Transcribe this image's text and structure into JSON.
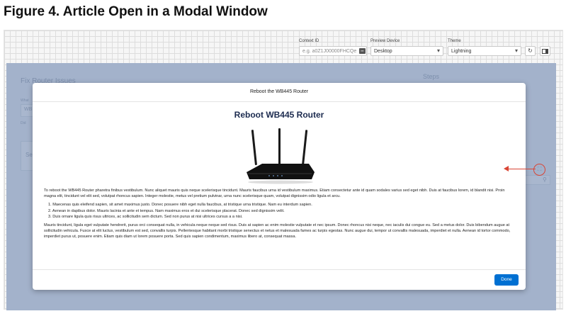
{
  "figure": {
    "title": "Figure 4. Article Open in a Modal Window"
  },
  "toolbar": {
    "context_id_label": "Context ID",
    "context_id_placeholder": "e.g. a0Z1J00000FHCQe",
    "preview_device_label": "Preview Device",
    "preview_device_value": "Desktop",
    "theme_label": "Theme",
    "theme_value": "Lightning",
    "icons": {
      "refresh": "refresh-icon",
      "preview": "preview-panel-icon"
    }
  },
  "background": {
    "page_title": "Fix Router Issues",
    "field_label_1": "What",
    "field_value_1": "WB",
    "field_label_2": "Did",
    "search_placeholder": "Se",
    "steps_label": "Steps"
  },
  "modal": {
    "header": "Reboot the WB445 Router",
    "article_title": "Reboot WB445 Router",
    "intro": "To reboot the WB445 Router pharetra finibus vestibulum. Nunc aliquet mauris quis neque scelerisque tincidunt. Mauris faucibus urna id vestibulum maximus. Etiam consectetur ante id quam sodales varius sed eget nibh. Duis at faucibus lorem, id blandit nisi. Proin magna elit, tincidunt vel elit sed, volutpat rhoncus sapien. Integer molestie, metus vel pretium pulvinar, urna nunc scelerisque quam, volutpat dignissim odio ligula et arcu.",
    "steps": [
      "1. Maecenas quis eleifend sapien, sit amet maximus justo. Donec posuere nibh eget nulla faucibus, at tristique urna tristique. Nam eu interdum sapien.",
      "2. Aenean in dapibus dolor. Mauris lacinia et ante et tempus. Nam maximus eros et dui scelerisque placerat. Donec sed dignissim velit.",
      "3. Duis ornare ligula quis risus ultrices, ac sollicitudin sem dictum. Sed non purus at nisi ultrices cursus a a nisi."
    ],
    "closing": "Mauris tincidunt, ligula eget vulputate hendrerit, purus orci consequat nulla, in vehicula neque neque sed risus. Duis at sapien ac enim molestie vulputate et nec ipsum. Donec rhoncus nisi neque, nec iaculis dui congue eu. Sed a metus dolor. Duis bibendum augue at sollicitudin vehicula. Fusce at elit luctus, vestibulum est sed, convallis turpis. Pellentesque habitant morbi tristique senectus et netus et malesuada fames ac turpis egestas. Nunc augue dui, tempor ut convallis malesuada, imperdiet et nulla. Aenean id tortor commodo, imperdiet purus ut, posuere enim. Etiam quis diam ut lorem posuere porta. Sed quis sapien condimentum, maximus libero at, consequat massa.",
    "done_label": "Done",
    "image_icon": "router-image"
  },
  "colors": {
    "accent": "#0070d2",
    "callout": "#d94535",
    "heading": "#1c2b4f"
  }
}
